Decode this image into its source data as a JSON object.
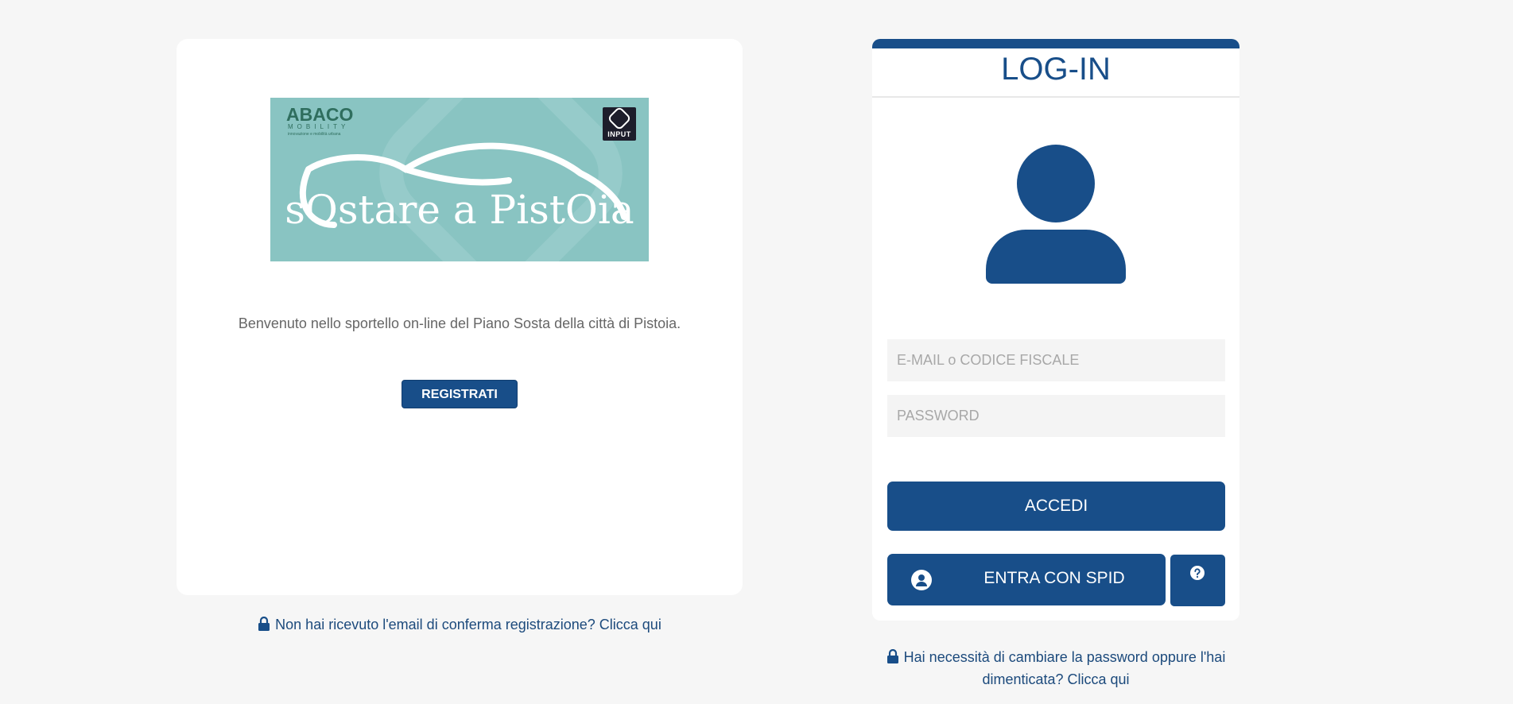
{
  "banner": {
    "brand": "ABACO",
    "brand_sub": "MOBILITY",
    "brand_tagline": "innovazione e mobilità urbana",
    "partner_logo": "INPUT",
    "title": "sOstare a PistOia"
  },
  "left": {
    "welcome_text": "Benvenuto nello sportello on-line del Piano Sosta della città di Pistoia.",
    "register_label": "REGISTRATI",
    "confirm_link": "Non hai ricevuto l'email di conferma registrazione? Clicca qui"
  },
  "login": {
    "title": "LOG-IN",
    "email_placeholder": "E-MAIL o CODICE FISCALE",
    "password_placeholder": "PASSWORD",
    "accedi_label": "ACCEDI",
    "spid_label": "ENTRA CON SPID",
    "reset_link": "Hai necessità di cambiare la password oppure l'hai dimenticata? Clicca qui"
  },
  "icons": {
    "user": "user-icon",
    "lock": "lock-icon",
    "spid": "spid-user-icon",
    "help": "question-circle-icon"
  },
  "colors": {
    "primary": "#184e89",
    "background": "#f6f6f6",
    "banner_bg": "#89c4c2",
    "link": "#1c4a7c"
  }
}
